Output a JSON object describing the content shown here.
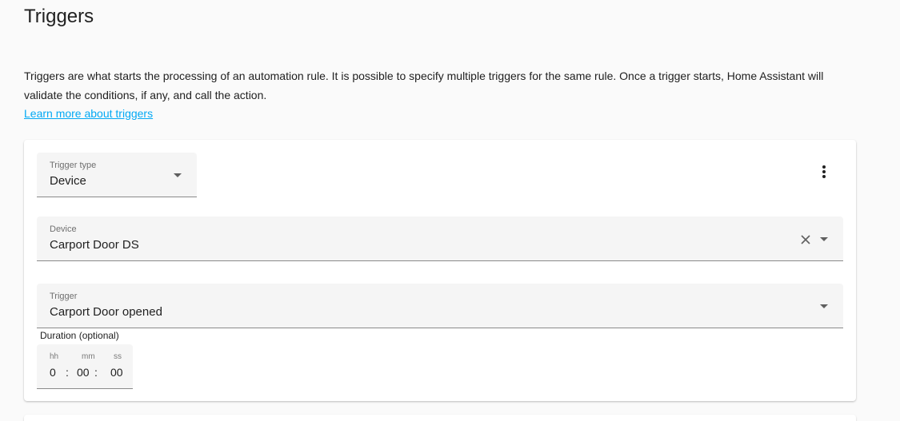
{
  "page": {
    "title": "Triggers",
    "description": "Triggers are what starts the processing of an automation rule. It is possible to specify multiple triggers for the same rule. Once a trigger starts, Home Assistant will validate the conditions, if any, and call the action.",
    "learn_more": "Learn more about triggers"
  },
  "trigger_card": {
    "trigger_type": {
      "label": "Trigger type",
      "value": "Device",
      "icon": "chevron-down-icon"
    },
    "menu_icon": "dots-vertical-icon",
    "device": {
      "label": "Device",
      "value": "Carport Door DS",
      "clear_icon": "close-icon",
      "dropdown_icon": "chevron-down-icon"
    },
    "trigger": {
      "label": "Trigger",
      "value": "Carport Door opened",
      "dropdown_icon": "chevron-down-icon"
    },
    "duration": {
      "label": "Duration (optional)",
      "hours_label": "hh",
      "hours_value": "0",
      "minutes_label": "mm",
      "minutes_value": "00",
      "seconds_label": "ss",
      "seconds_value": "00",
      "separator": ":"
    }
  },
  "colors": {
    "link": "#03a9f4",
    "field_bg": "#f5f5f5",
    "card_bg": "#ffffff",
    "page_bg": "#fafafa"
  }
}
